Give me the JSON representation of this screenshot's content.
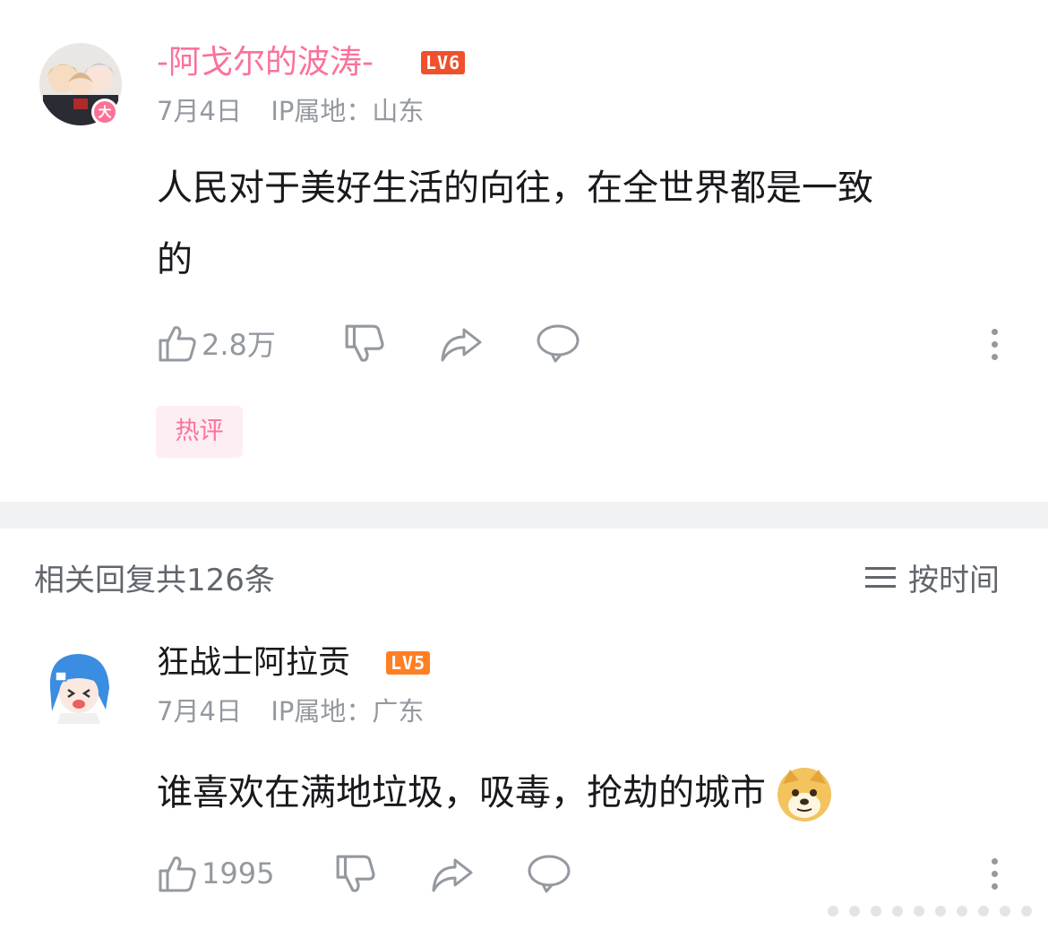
{
  "main_comment": {
    "username": "-阿戈尔的波涛-",
    "level": "LV6",
    "avatar_badge": "大",
    "date": "7月4日",
    "ip_location": "IP属地：山东",
    "text_line1": "人民对于美好生活的向往，在全世界都是一致",
    "text_line2": "的",
    "like_count": "2.8万",
    "hot_tag": "热评"
  },
  "replies_header": {
    "title": "相关回复共126条",
    "sort_label": "按时间"
  },
  "reply": {
    "username": "狂战士阿拉贡",
    "level": "LV5",
    "date": "7月4日",
    "ip_location": "IP属地：广东",
    "text": "谁喜欢在满地垃圾，吸毒，抢劫的城市",
    "like_count": "1995"
  },
  "colors": {
    "accent_pink": "#fb7299",
    "lv6": "#f0502c",
    "lv5": "#ff7f24",
    "meta_gray": "#9499a0",
    "separator": "#f1f2f3"
  },
  "icons": [
    "like-icon",
    "dislike-icon",
    "share-icon",
    "comment-icon",
    "more-icon",
    "sort-icon",
    "doge-emoji"
  ]
}
